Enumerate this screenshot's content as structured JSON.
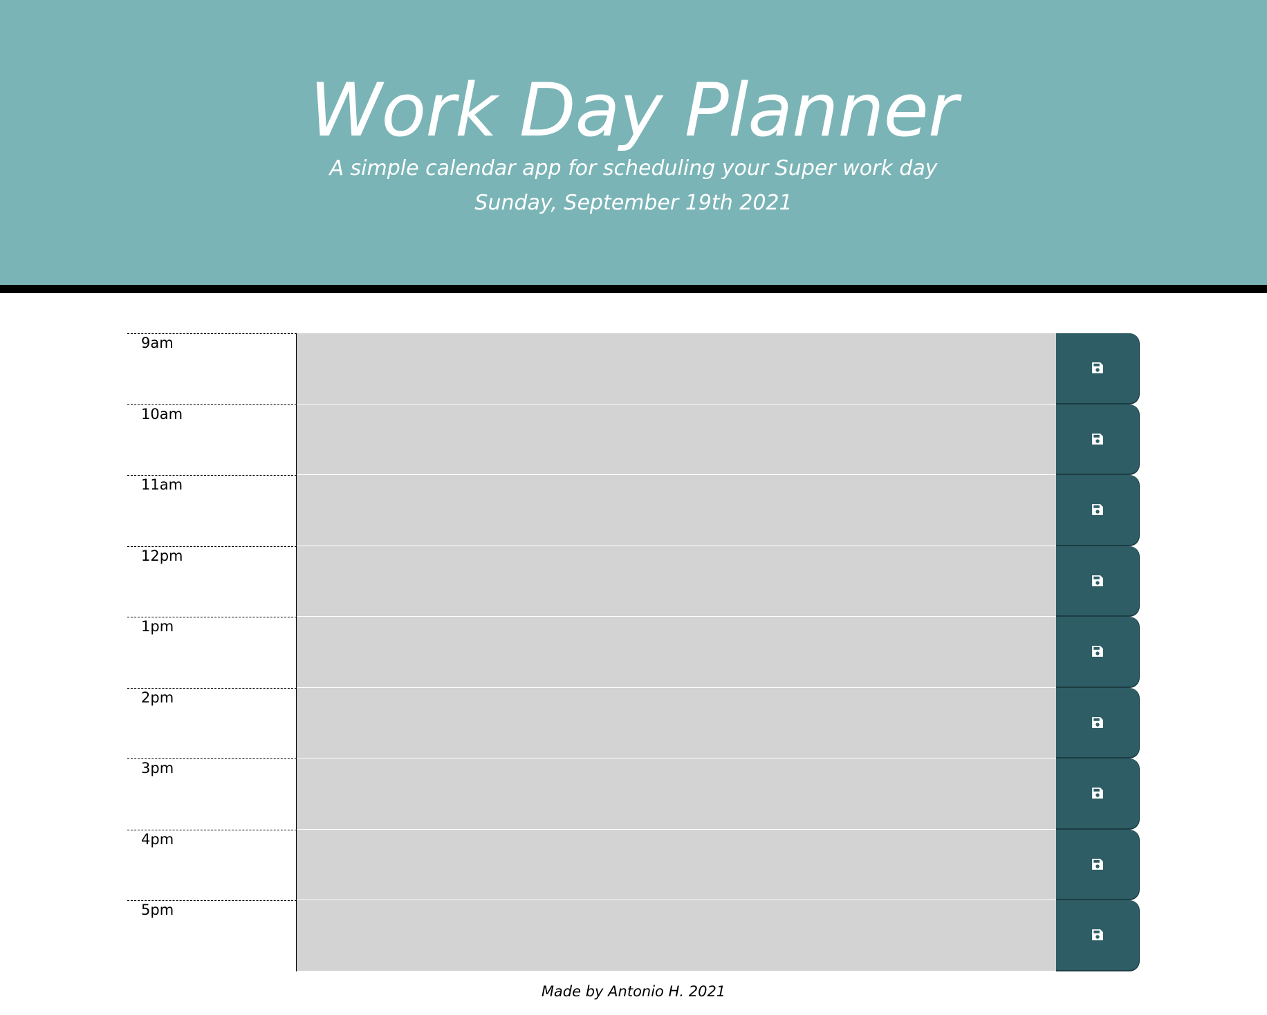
{
  "header": {
    "title": "Work Day Planner",
    "subtitle": "A simple calendar app for scheduling your Super work day",
    "current_day": "Sunday, September 19th 2021"
  },
  "time_blocks": [
    {
      "hour": "9am",
      "description": ""
    },
    {
      "hour": "10am",
      "description": ""
    },
    {
      "hour": "11am",
      "description": ""
    },
    {
      "hour": "12pm",
      "description": ""
    },
    {
      "hour": "1pm",
      "description": ""
    },
    {
      "hour": "2pm",
      "description": ""
    },
    {
      "hour": "3pm",
      "description": ""
    },
    {
      "hour": "4pm",
      "description": ""
    },
    {
      "hour": "5pm",
      "description": ""
    }
  ],
  "save_icon": "floppy-disk-icon",
  "footer": {
    "credit": "Made by Antonio H. 2021"
  },
  "colors": {
    "header_bg": "#7ab4b6",
    "textarea_bg": "#d3d3d3",
    "save_button_bg": "#2e5d66"
  }
}
